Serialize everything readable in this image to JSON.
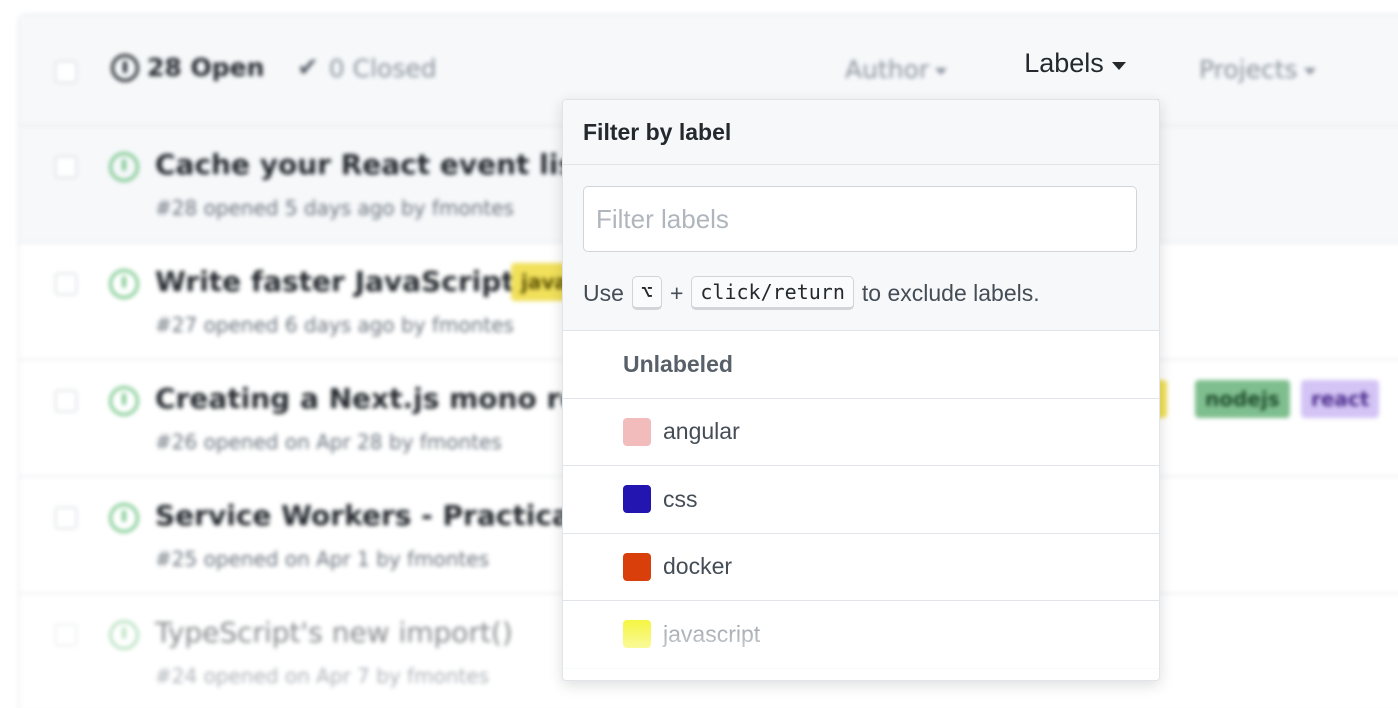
{
  "header": {
    "open_count": "28 Open",
    "closed_count": "0 Closed",
    "filters": {
      "author": "Author",
      "labels": "Labels",
      "projects": "Projects"
    }
  },
  "issues": [
    {
      "title": "Cache your React event lis",
      "meta": "#28 opened 5 days ago by fmontes"
    },
    {
      "title": "Write faster JavaScript",
      "meta": "#27 opened 6 days ago by fmontes",
      "tag": "javascript"
    },
    {
      "title": "Creating a Next.js mono re",
      "meta": "#26 opened on Apr 28 by fmontes",
      "tags": [
        "nodejs",
        "react"
      ]
    },
    {
      "title": "Service Workers - Practica",
      "meta": "#25 opened on Apr 1 by fmontes"
    },
    {
      "title": "TypeScript's new import()",
      "meta": "#24 opened on Apr 7 by fmontes"
    }
  ],
  "dropdown": {
    "title": "Filter by label",
    "filter_placeholder": "Filter labels",
    "hint_prefix": "Use",
    "hint_key_alt": "⌥",
    "hint_plus": "+",
    "hint_key_click": "click/return",
    "hint_suffix": "to exclude labels.",
    "unlabeled": "Unlabeled",
    "labels": [
      {
        "name": "angular",
        "color": "#f2bcbc"
      },
      {
        "name": "css",
        "color": "#2315b0"
      },
      {
        "name": "docker",
        "color": "#d93f0b"
      },
      {
        "name": "javascript",
        "color": "#f5f542"
      }
    ]
  },
  "colors": {
    "open_green": "#28a745",
    "tag_javascript": "#f1e05a",
    "tag_nodejs": "#7fbf8f",
    "tag_react": "#d3c4f5"
  }
}
